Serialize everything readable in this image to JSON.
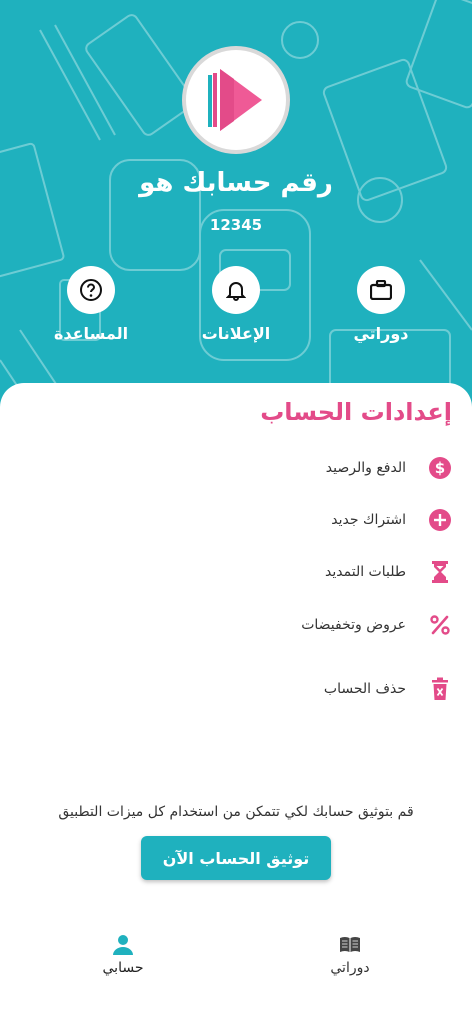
{
  "header": {
    "title": "رقم حسابك هو",
    "account_number": "12345"
  },
  "quick_actions": [
    {
      "label": "دوراتي",
      "icon": "briefcase-icon"
    },
    {
      "label": "الإعلانات",
      "icon": "bell-icon"
    },
    {
      "label": "المساعدة",
      "icon": "question-icon"
    }
  ],
  "settings": {
    "title": "إعدادات الحساب",
    "items": [
      {
        "label": "الدفع والرصيد",
        "icon": "dollar-icon"
      },
      {
        "label": "اشتراك جديد",
        "icon": "plus-icon"
      },
      {
        "label": "طلبات التمديد",
        "icon": "hourglass-icon"
      },
      {
        "label": "عروض وتخفيضات",
        "icon": "percent-icon"
      },
      {
        "label": "حذف الحساب",
        "icon": "trash-icon"
      }
    ]
  },
  "verify": {
    "note": "قم بتوثيق حسابك لكي تتمكن من استخدام كل ميزات التطبيق",
    "button_label": "توثيق الحساب الآن"
  },
  "bottom_nav": [
    {
      "label": "حسابي",
      "icon": "user-icon",
      "active": true
    },
    {
      "label": "دوراتي",
      "icon": "book-icon",
      "active": false
    }
  ],
  "colors": {
    "primary": "#1fb1be",
    "accent": "#e34b89"
  }
}
